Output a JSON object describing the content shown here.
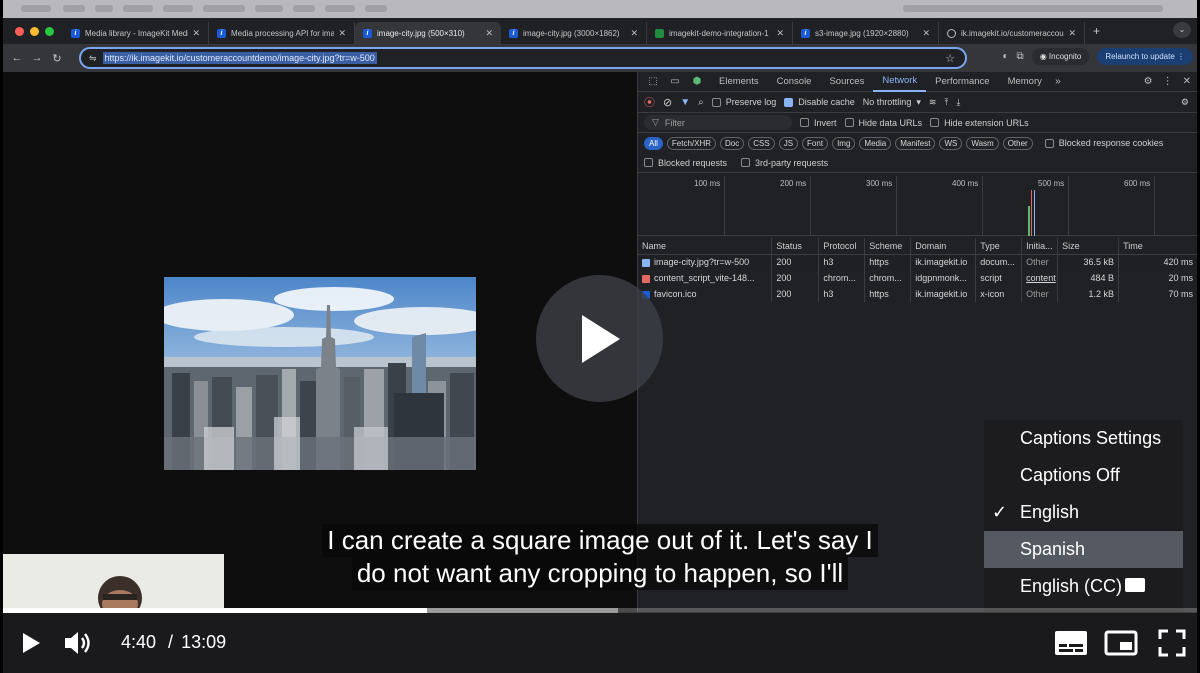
{
  "browser": {
    "tabs": [
      {
        "title": "Media library - ImageKit Media",
        "icon": "imagekit-icon"
      },
      {
        "title": "Media processing API for images",
        "icon": "imagekit-icon"
      },
      {
        "title": "image-city.jpg (500×310)",
        "icon": "imagekit-icon",
        "active": true
      },
      {
        "title": "image-city.jpg (3000×1862)",
        "icon": "imagekit-icon"
      },
      {
        "title": "imagekit-demo-integration-1",
        "icon": "green-square-icon"
      },
      {
        "title": "s3-image.jpg (1920×2880)",
        "icon": "imagekit-icon"
      },
      {
        "title": "ik.imagekit.io/customeraccou",
        "icon": "globe-icon"
      }
    ],
    "url": "https://ik.imagekit.io/customeraccountdemo/image-city.jpg?tr=w-500",
    "incognito_label": "Incognito",
    "relaunch_label": "Relaunch to update"
  },
  "devtools": {
    "tabs": [
      "Elements",
      "Console",
      "Sources",
      "Network",
      "Performance",
      "Memory"
    ],
    "active_tab": "Network",
    "toolbar": {
      "preserve_log": "Preserve log",
      "disable_cache": "Disable cache",
      "throttling": "No throttling"
    },
    "filter_placeholder": "Filter",
    "filter_options": {
      "invert": "Invert",
      "hide_data_urls": "Hide data URLs",
      "hide_extension_urls": "Hide extension URLs"
    },
    "type_chips": [
      "All",
      "Fetch/XHR",
      "Doc",
      "CSS",
      "JS",
      "Font",
      "Img",
      "Media",
      "Manifest",
      "WS",
      "Wasm",
      "Other"
    ],
    "blocked_response_cookies": "Blocked response cookies",
    "blocked_requests": "Blocked requests",
    "third_party_requests": "3rd-party requests",
    "timeline_ticks": [
      "100 ms",
      "200 ms",
      "300 ms",
      "400 ms",
      "500 ms",
      "600 ms"
    ],
    "columns": [
      "Name",
      "Status",
      "Protocol",
      "Scheme",
      "Domain",
      "Type",
      "Initia...",
      "Size",
      "Time"
    ],
    "requests": [
      {
        "name": "image-city.jpg?tr=w-500",
        "status": "200",
        "protocol": "h3",
        "scheme": "https",
        "domain": "ik.imagekit.io",
        "type": "docum...",
        "initiator": "Other",
        "size": "36.5 kB",
        "time": "420 ms",
        "icon": "document-icon"
      },
      {
        "name": "content_script_vite-148...",
        "status": "200",
        "protocol": "chrom...",
        "scheme": "chrom...",
        "domain": "idgpnmonk...",
        "type": "script",
        "initiator": "content",
        "size": "484 B",
        "time": "20 ms",
        "icon": "script-icon"
      },
      {
        "name": "favicon.ico",
        "status": "200",
        "protocol": "h3",
        "scheme": "https",
        "domain": "ik.imagekit.io",
        "type": "x-icon",
        "initiator": "Other",
        "size": "1.2 kB",
        "time": "70 ms",
        "icon": "imagekit-icon"
      }
    ]
  },
  "captions": {
    "line1": "I can create a square image out of it. Let's say I",
    "line2": "do not want any cropping to happen, so I'll"
  },
  "caption_menu": {
    "items": [
      {
        "label": "Captions Settings",
        "checked": false,
        "highlighted": false
      },
      {
        "label": "Captions Off",
        "checked": false,
        "highlighted": false
      },
      {
        "label": "English",
        "checked": true,
        "highlighted": false
      },
      {
        "label": "Spanish",
        "checked": false,
        "highlighted": true
      },
      {
        "label": "English (CC)",
        "checked": false,
        "highlighted": false,
        "badge": "CC"
      }
    ],
    "check_glyph": "✓"
  },
  "player": {
    "current_time": "4:40",
    "duration": "13:09",
    "separator": "/",
    "progress_fraction": 0.355,
    "buffered_fraction": 0.515,
    "accent": "#ffffff"
  }
}
